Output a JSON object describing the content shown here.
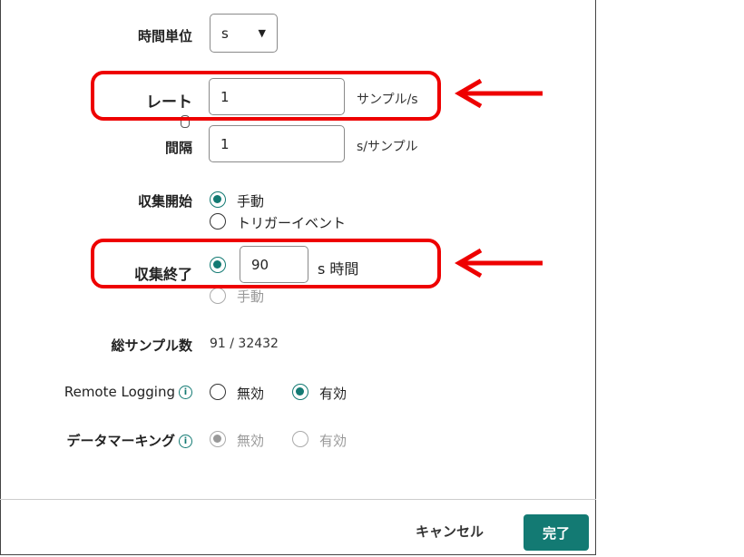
{
  "time_unit": {
    "label": "時間単位",
    "value": "s",
    "icon": "triangle-down"
  },
  "rate": {
    "label": "レート",
    "value": "1",
    "unit": "サンプル/s"
  },
  "interval": {
    "label": "間隔",
    "value": "1",
    "unit": "s/サンプル"
  },
  "collect_start": {
    "label": "収集開始",
    "options": [
      "手動",
      "トリガーイベント"
    ],
    "selected": 0
  },
  "collect_end": {
    "label": "収集終了",
    "duration_value": "90",
    "duration_unit": "s 時間",
    "manual_label": "手動"
  },
  "total_samples": {
    "label": "総サンプル数",
    "value": "91 / 32432"
  },
  "remote_logging": {
    "label": "Remote Logging",
    "options": [
      "無効",
      "有効"
    ],
    "selected": 1
  },
  "data_marking": {
    "label": "データマーキング",
    "options": [
      "無効",
      "有効"
    ],
    "selected": 0,
    "disabled": true
  },
  "footer": {
    "cancel": "キャンセル",
    "done": "完了"
  },
  "colors": {
    "accent": "#137a73",
    "highlight": "#e00000"
  }
}
